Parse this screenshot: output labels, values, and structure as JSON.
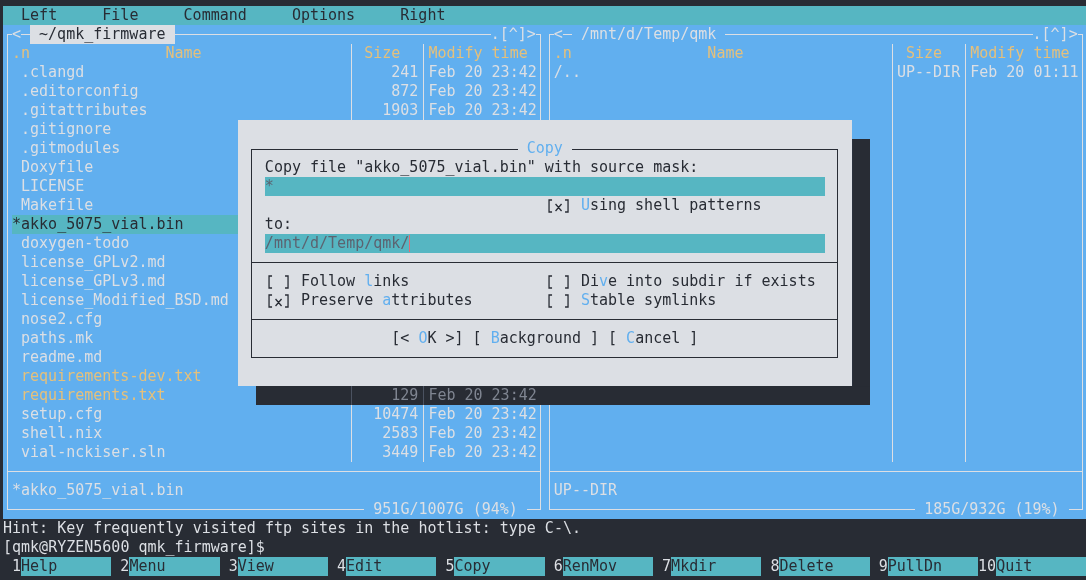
{
  "menu": [
    "Left",
    "File",
    "Command",
    "Options",
    "Right"
  ],
  "left_panel": {
    "active": true,
    "history_mark": "<",
    "path": "~/qmk_firmware",
    "controls": ".[^]>",
    "headers": {
      "sort": ".n",
      "name": "Name",
      "size": "Size",
      "time": "Modify time"
    },
    "files": [
      {
        "name": ".clangd",
        "kind": "file",
        "color": "#dcdfe4",
        "size": "241",
        "time": "Feb 20 23:42",
        "selected": false
      },
      {
        "name": ".editorconfig",
        "kind": "file",
        "color": "#dcdfe4",
        "size": "872",
        "time": "Feb 20 23:42",
        "selected": false
      },
      {
        "name": ".gitattributes",
        "kind": "file",
        "color": "#dcdfe4",
        "size": "1903",
        "time": "Feb 20 23:42",
        "selected": false
      },
      {
        "name": ".gitignore",
        "kind": "file",
        "color": "#dcdfe4",
        "selected": false
      },
      {
        "name": ".gitmodules",
        "kind": "file",
        "color": "#dcdfe4",
        "selected": false
      },
      {
        "name": "Doxyfile",
        "kind": "file",
        "color": "#dcdfe4",
        "selected": false
      },
      {
        "name": "LICENSE",
        "kind": "file",
        "color": "#dcdfe4",
        "selected": false
      },
      {
        "name": "Makefile",
        "kind": "file",
        "color": "#dcdfe4",
        "selected": false
      },
      {
        "name": "*akko_5075_vial.bin",
        "kind": "executable",
        "selected": true
      },
      {
        "name": "doxygen-todo",
        "kind": "file",
        "color": "#dcdfe4",
        "selected": false
      },
      {
        "name": "license_GPLv2.md",
        "kind": "file",
        "color": "#dcdfe4",
        "selected": false
      },
      {
        "name": "license_GPLv3.md",
        "kind": "file",
        "color": "#dcdfe4",
        "selected": false
      },
      {
        "name": "license_Modified_BSD.md",
        "kind": "file",
        "color": "#dcdfe4",
        "selected": false
      },
      {
        "name": "nose2.cfg",
        "kind": "file",
        "color": "#dcdfe4",
        "selected": false
      },
      {
        "name": "paths.mk",
        "kind": "file",
        "color": "#dcdfe4",
        "selected": false
      },
      {
        "name": "readme.md",
        "kind": "file",
        "color": "#dcdfe4",
        "selected": false
      },
      {
        "name": "requirements-dev.txt",
        "kind": "file",
        "color": "#e5c07b",
        "selected": false
      },
      {
        "name": "requirements.txt",
        "kind": "file",
        "color": "#e5c07b",
        "size": "129",
        "time": "Feb 20 23:42",
        "selected": false,
        "shaded": true
      },
      {
        "name": "setup.cfg",
        "kind": "file",
        "color": "#dcdfe4",
        "size": "10474",
        "time": "Feb 20 23:42",
        "selected": false
      },
      {
        "name": "shell.nix",
        "kind": "file",
        "color": "#dcdfe4",
        "size": "2583",
        "time": "Feb 20 23:42",
        "selected": false
      },
      {
        "name": "vial-nckiser.sln",
        "kind": "file",
        "color": "#dcdfe4",
        "size": "3449",
        "time": "Feb 20 23:42",
        "selected": false
      }
    ],
    "status": "*akko_5075_vial.bin",
    "disk": "951G/1007G (94%)"
  },
  "right_panel": {
    "active": false,
    "history_mark": "<",
    "path": "/mnt/d/Temp/qmk",
    "controls": ".[^]>",
    "headers": {
      "sort": ".n",
      "name": "Name",
      "size": "Size",
      "time": "Modify time"
    },
    "files": [
      {
        "name": "/..",
        "kind": "updir",
        "color": "#dcdfe4",
        "size": "UP--DIR",
        "time": "Feb 20 01:11",
        "selected": false
      }
    ],
    "status": "UP--DIR",
    "disk": "185G/932G (19%)"
  },
  "copy_dialog": {
    "title": "Copy",
    "prompt": "Copy file \"akko_5075_vial.bin\" with source mask:",
    "source_mask": {
      "value": "*",
      "focused": false
    },
    "shell_patterns": {
      "checked": true,
      "hot": "U",
      "post": "sing shell patterns"
    },
    "to_label": "to:",
    "destination": {
      "value": "/mnt/d/Temp/qmk/",
      "focused": true
    },
    "options": [
      {
        "checked": false,
        "pre": "Follow ",
        "hot": "l",
        "post": "inks"
      },
      {
        "checked": false,
        "pre": "Di",
        "hot": "v",
        "post": "e into subdir if exists"
      },
      {
        "checked": true,
        "pre": "Preserve ",
        "hot": "a",
        "post": "ttributes"
      },
      {
        "checked": false,
        "hot": "S",
        "post": "table symlinks"
      }
    ],
    "buttons": [
      {
        "pre": "[< ",
        "hot": "O",
        "post": "K >]"
      },
      {
        "pre": "[ ",
        "hot": "B",
        "post": "ackground ]"
      },
      {
        "pre": "[ ",
        "hot": "C",
        "post": "ancel ]"
      }
    ]
  },
  "hint": "Hint: Key frequently visited ftp sites in the hotlist: type C-\\.",
  "prompt": "[qmk@RYZEN5600 qmk_firmware]$",
  "function_keys": [
    {
      "key": "1",
      "label": "Help"
    },
    {
      "key": "2",
      "label": "Menu"
    },
    {
      "key": "3",
      "label": "View"
    },
    {
      "key": "4",
      "label": "Edit"
    },
    {
      "key": "5",
      "label": "Copy"
    },
    {
      "key": "6",
      "label": "RenMov"
    },
    {
      "key": "7",
      "label": "Mkdir"
    },
    {
      "key": "8",
      "label": "Delete"
    },
    {
      "key": "9",
      "label": "PullDn"
    },
    {
      "key": "10",
      "label": "Quit"
    }
  ]
}
